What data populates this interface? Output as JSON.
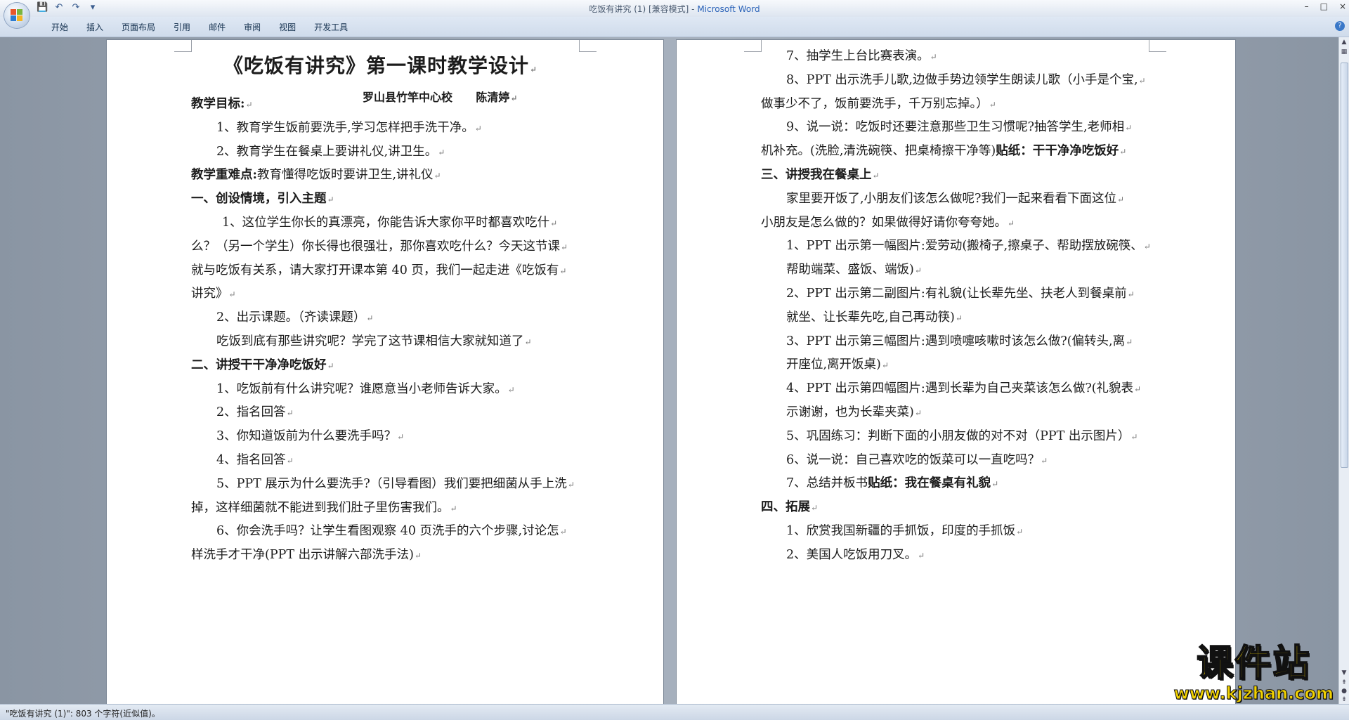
{
  "window": {
    "doc_title": "吃饭有讲究 (1) [兼容模式] - ",
    "app_name": "Microsoft Word",
    "controls": [
      "–",
      "□",
      "×"
    ],
    "help": "?"
  },
  "ribbon": {
    "tabs": [
      "开始",
      "插入",
      "页面布局",
      "引用",
      "邮件",
      "审阅",
      "视图",
      "开发工具"
    ]
  },
  "page1": {
    "title": "《吃饭有讲究》第一课时教学设计",
    "author": "罗山县竹竿中心校      陈清婷",
    "lines": [
      {
        "text": "教学目标:",
        "bold": true,
        "indent": 0
      },
      {
        "text": "1、教育学生饭前要洗手,学习怎样把手洗干净。",
        "bold": false,
        "indent": 36
      },
      {
        "text": "2、教育学生在餐桌上要讲礼仪,讲卫生。",
        "bold": false,
        "indent": 36
      },
      {
        "text": "教学重难点:教育懂得吃饭时要讲卫生,讲礼仪",
        "bold": false,
        "indent": 0,
        "bold_prefix": "教学重难点:"
      },
      {
        "text": "一、创设情境，引入主题",
        "bold": true,
        "indent": 0
      },
      {
        "text": "1、这位学生你长的真漂亮，你能告诉大家你平时都喜欢吃什",
        "bold": false,
        "indent": 44
      },
      {
        "text": "么？（另一个学生）你长得也很强壮，那你喜欢吃什么？今天这节课",
        "bold": false,
        "indent": 0
      },
      {
        "text": "就与吃饭有关系，请大家打开课本第 40 页，我们一起走进《吃饭有",
        "bold": false,
        "indent": 0
      },
      {
        "text": "讲究》",
        "bold": false,
        "indent": 0
      },
      {
        "text": "2、出示课题。（齐读课题）",
        "bold": false,
        "indent": 36
      },
      {
        "text": "吃饭到底有那些讲究呢？学完了这节课相信大家就知道了",
        "bold": false,
        "indent": 36
      },
      {
        "text": "二、讲授干干净净吃饭好",
        "bold": true,
        "indent": 0
      },
      {
        "text": "1、吃饭前有什么讲究呢？谁愿意当小老师告诉大家。",
        "bold": false,
        "indent": 36
      },
      {
        "text": "2、指名回答",
        "bold": false,
        "indent": 36
      },
      {
        "text": "3、你知道饭前为什么要洗手吗？",
        "bold": false,
        "indent": 36
      },
      {
        "text": "4、指名回答",
        "bold": false,
        "indent": 36
      },
      {
        "text": "5、PPT 展示为什么要洗手?（引导看图）我们要把细菌从手上洗",
        "bold": false,
        "indent": 36
      },
      {
        "text": "掉，这样细菌就不能进到我们肚子里伤害我们。",
        "bold": false,
        "indent": 0
      },
      {
        "text": "6、你会洗手吗？让学生看图观察 40 页洗手的六个步骤,讨论怎",
        "bold": false,
        "indent": 36
      },
      {
        "text": "样洗手才干净(PPT 出示讲解六部洗手法)",
        "bold": false,
        "indent": 0
      }
    ]
  },
  "page2": {
    "lines": [
      {
        "text": "7、抽学生上台比赛表演。",
        "bold": false,
        "indent": 36
      },
      {
        "text": "8、PPT 出示洗手儿歌,边做手势边领学生朗读儿歌（小手是个宝,",
        "bold": false,
        "indent": 36
      },
      {
        "text": "做事少不了，饭前要洗手，千万别忘掉。）",
        "bold": false,
        "indent": 0
      },
      {
        "text": "9、说一说：吃饭时还要注意那些卫生习惯呢?抽答学生,老师相",
        "bold": false,
        "indent": 36
      },
      {
        "text": "机补充。(洗脸,清洗碗筷、把桌椅擦干净等)",
        "bold": false,
        "indent": 0,
        "bold_suffix": "贴纸：干干净净吃饭好"
      },
      {
        "text": "三、讲授我在餐桌上",
        "bold": true,
        "indent": 0
      },
      {
        "text": "家里要开饭了,小朋友们该怎么做呢?我们一起来看看下面这位",
        "bold": false,
        "indent": 36
      },
      {
        "text": "小朋友是怎么做的？如果做得好请你夸夸她。",
        "bold": false,
        "indent": 0
      },
      {
        "text": "1、PPT 出示第一幅图片:爱劳动(搬椅子,擦桌子、帮助摆放碗筷、",
        "bold": false,
        "indent": 36
      },
      {
        "text": "帮助端菜、盛饭、端饭)",
        "bold": false,
        "indent": 36
      },
      {
        "text": "2、PPT 出示第二副图片:有礼貌(让长辈先坐、扶老人到餐桌前",
        "bold": false,
        "indent": 36
      },
      {
        "text": "就坐、让长辈先吃,自己再动筷)",
        "bold": false,
        "indent": 36
      },
      {
        "text": "3、PPT 出示第三幅图片:遇到喷嚏咳嗽时该怎么做?(偏转头,离",
        "bold": false,
        "indent": 36
      },
      {
        "text": "开座位,离开饭桌)",
        "bold": false,
        "indent": 36
      },
      {
        "text": "4、PPT 出示第四幅图片:遇到长辈为自己夹菜该怎么做?(礼貌表",
        "bold": false,
        "indent": 36
      },
      {
        "text": "示谢谢，也为长辈夹菜)",
        "bold": false,
        "indent": 36
      },
      {
        "text": "5、巩固练习：判断下面的小朋友做的对不对（PPT 出示图片）",
        "bold": false,
        "indent": 36
      },
      {
        "text": "6、说一说：自己喜欢吃的饭菜可以一直吃吗？",
        "bold": false,
        "indent": 36
      },
      {
        "text": "7、总结并板书",
        "bold": false,
        "indent": 36,
        "bold_suffix": "贴纸：我在餐桌有礼貌"
      },
      {
        "text": "四、拓展",
        "bold": true,
        "indent": 0
      },
      {
        "text": "1、欣赏我国新疆的手抓饭，印度的手抓饭",
        "bold": false,
        "indent": 36
      },
      {
        "text": "2、美国人吃饭用刀叉。",
        "bold": false,
        "indent": 36
      }
    ]
  },
  "status": {
    "text": "\"吃饭有讲究 (1)\": 803 个字符(近似值)。"
  },
  "watermark": {
    "name": "课件站",
    "url": "www.kjzhan.com"
  }
}
